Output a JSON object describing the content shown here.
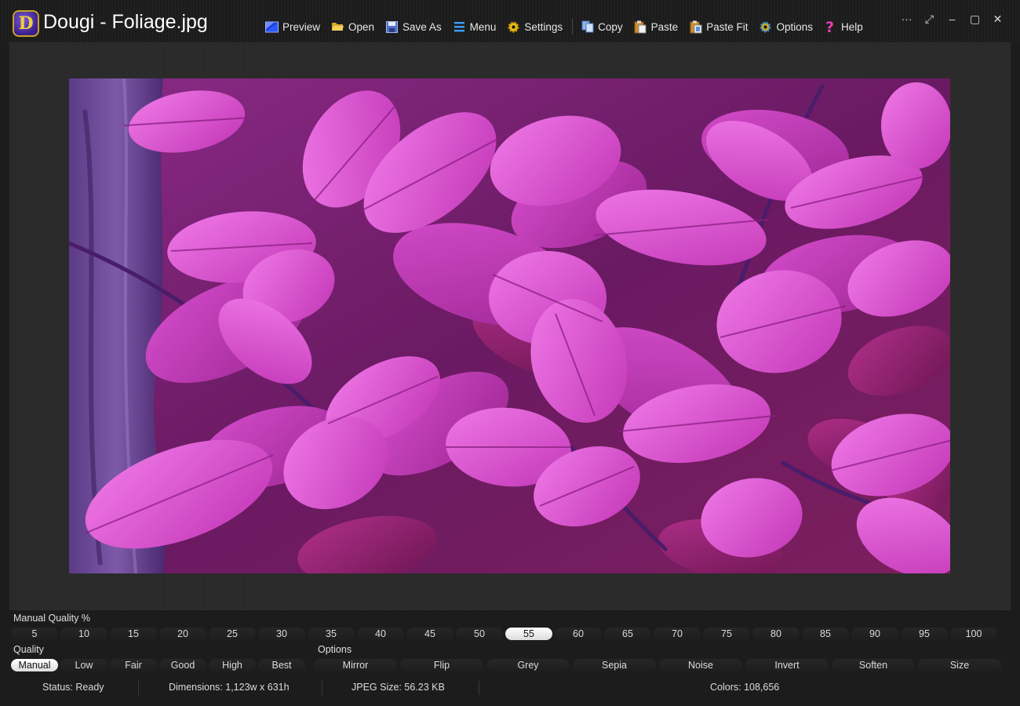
{
  "window": {
    "logo_letter": "D",
    "title": "Dougi - Foliage.jpg",
    "controls": [
      "···",
      "⤢",
      "–",
      "▢",
      "✕"
    ]
  },
  "toolbar": {
    "items": [
      {
        "label": "Preview",
        "icon": "preview-icon"
      },
      {
        "label": "Open",
        "icon": "folder-open-icon"
      },
      {
        "label": "Save As",
        "icon": "floppy-disk-icon"
      },
      {
        "label": "Menu",
        "icon": "hamburger-menu-icon"
      },
      {
        "label": "Settings",
        "icon": "gear-icon"
      },
      {
        "label": "Copy",
        "icon": "copy-icon"
      },
      {
        "label": "Paste",
        "icon": "clipboard-paste-icon"
      },
      {
        "label": "Paste Fit",
        "icon": "clipboard-paste-fit-icon"
      },
      {
        "label": "Options",
        "icon": "options-gear-icon"
      },
      {
        "label": "Help",
        "icon": "help-icon"
      }
    ]
  },
  "manual_quality": {
    "label": "Manual Quality %",
    "values": [
      "5",
      "10",
      "15",
      "20",
      "25",
      "30",
      "35",
      "40",
      "45",
      "50",
      "55",
      "60",
      "65",
      "70",
      "75",
      "80",
      "85",
      "90",
      "95",
      "100"
    ],
    "selected": "55"
  },
  "quality": {
    "label": "Quality",
    "values": [
      "Manual",
      "Low",
      "Fair",
      "Good",
      "High",
      "Best"
    ],
    "selected": "Manual"
  },
  "options": {
    "label": "Options",
    "values": [
      "Mirror",
      "Flip",
      "Grey",
      "Sepia",
      "Noise",
      "Invert",
      "Soften",
      "Size"
    ]
  },
  "status": {
    "status": "Status: Ready",
    "dimensions": "Dimensions: 1,123w x 631h",
    "jpeg_size": "JPEG Size: 56.23 KB",
    "colors": "Colors: 108,656"
  },
  "colors": {
    "background": "#1c1c1c",
    "canvas": "#2a2a2a",
    "selected_pill": "#ffffff",
    "leaf_light": "#e058d8",
    "leaf_mid": "#c23cb8",
    "leaf_dark": "#7a1f72",
    "bark": "#6b4a8e"
  }
}
